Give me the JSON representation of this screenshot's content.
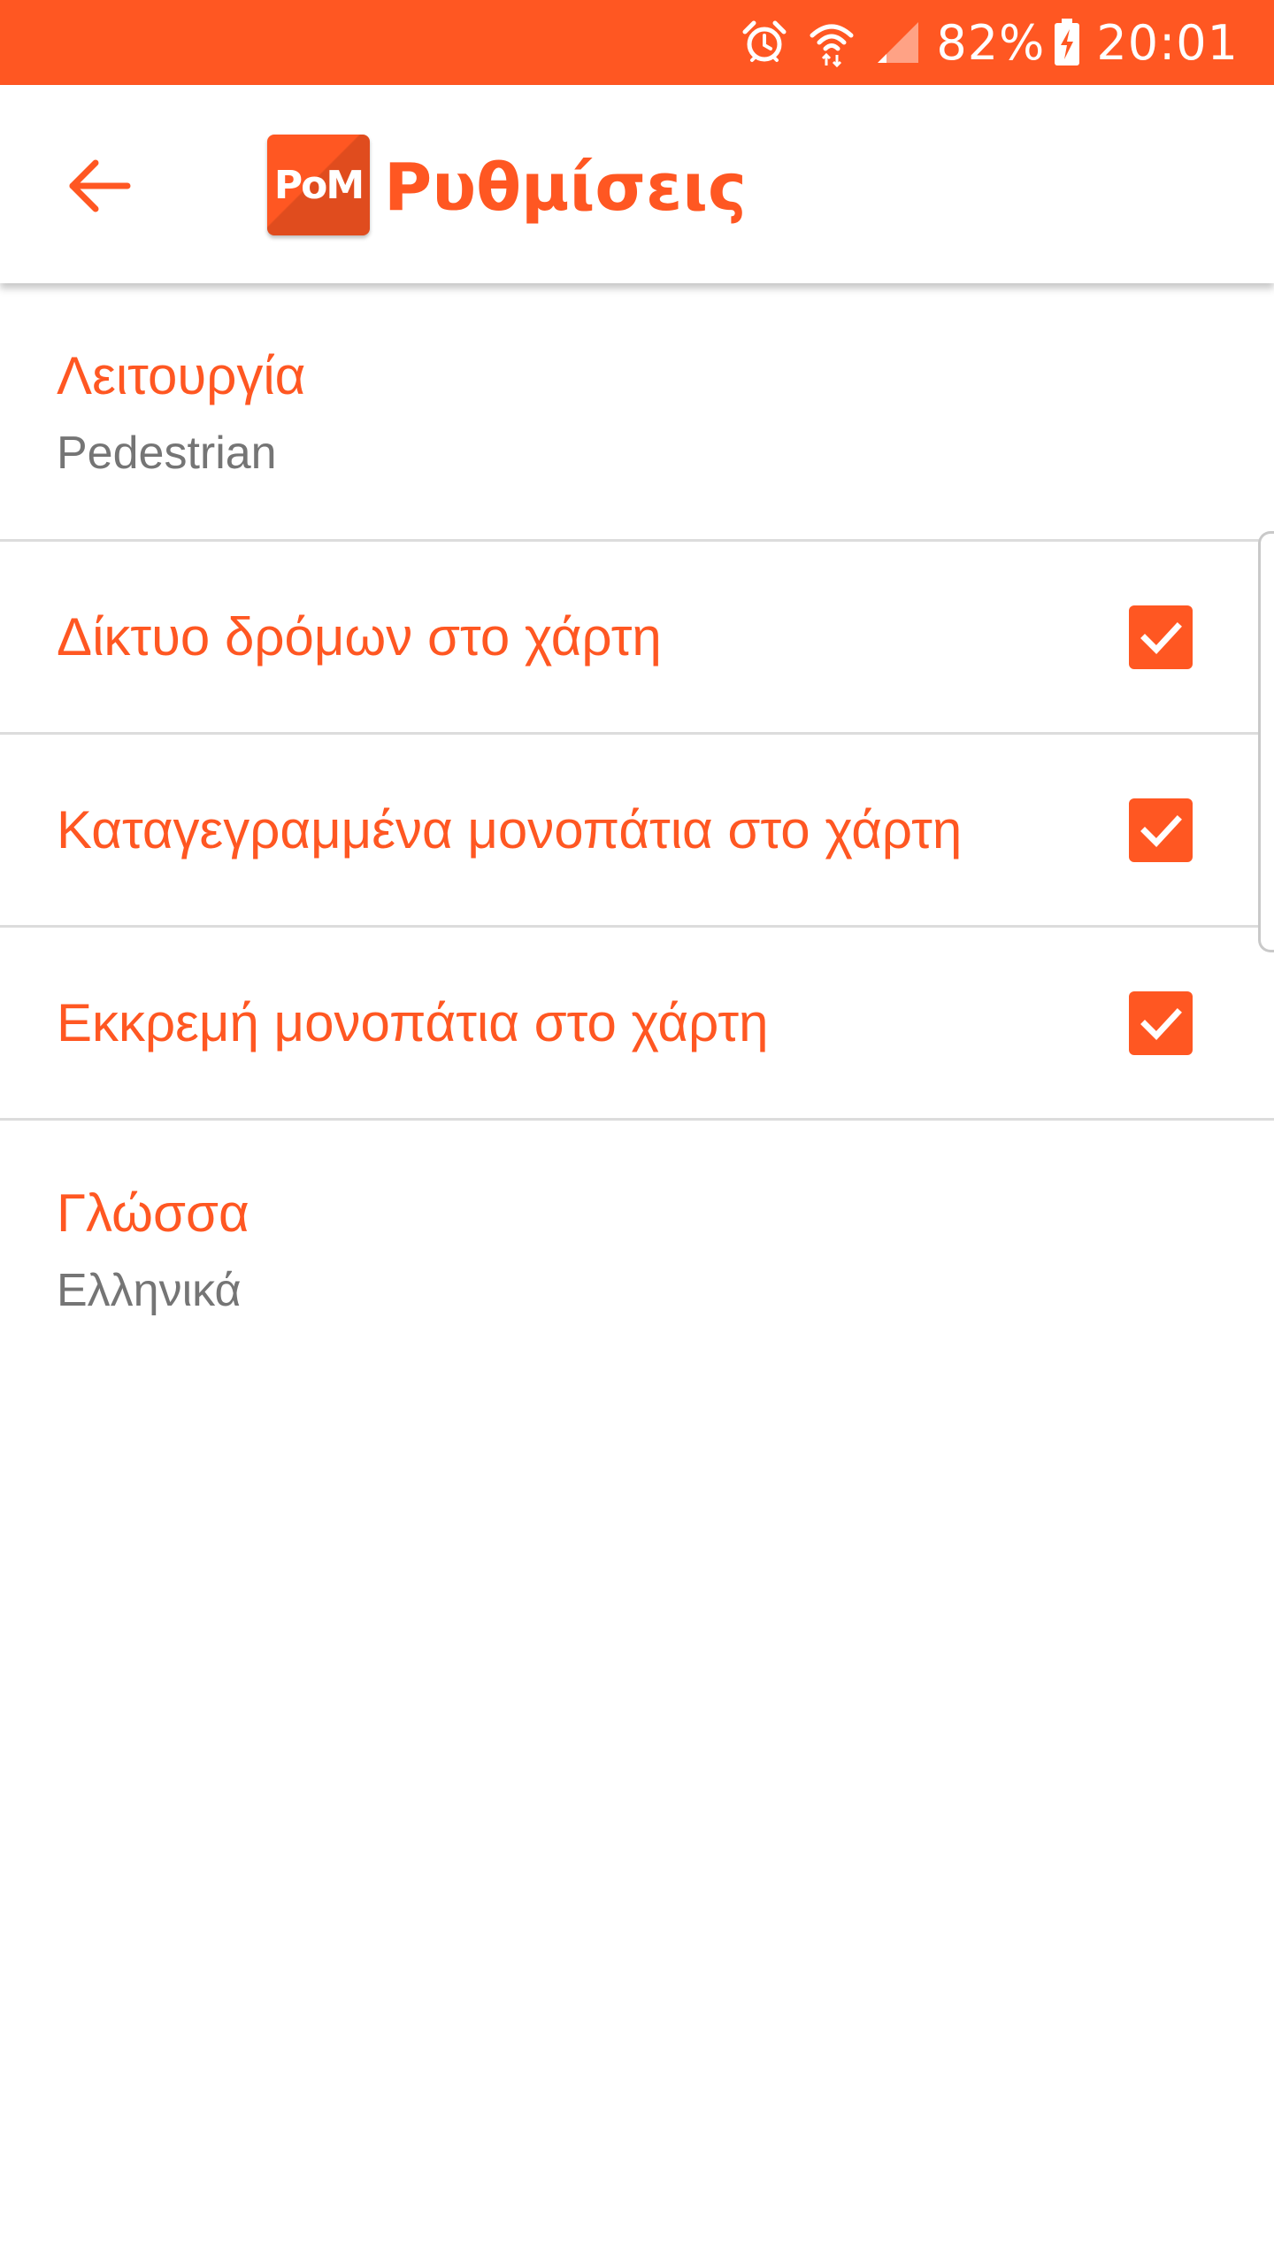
{
  "status_bar": {
    "battery": "82%",
    "time": "20:01",
    "icons": [
      "alarm-icon",
      "wifi-icon",
      "signal-icon",
      "battery-charging-icon"
    ],
    "background_color": "#FF5722"
  },
  "app_bar": {
    "logo_text": "PoM",
    "title": "Ρυθμίσεις",
    "back_icon": "arrow-left-icon"
  },
  "theme": {
    "accent": "#FF5722",
    "summary_text": "#757575",
    "divider": "#DCDCDC"
  },
  "preferences": [
    {
      "title": "Λειτουργία",
      "summary": "Pedestrian"
    },
    {
      "title": "Δίκτυο δρόμων στο χάρτη",
      "checked": true
    },
    {
      "title": "Καταγεγραμμένα μονοπάτια στο χάρτη",
      "checked": true
    },
    {
      "title": "Εκκρεμή μονοπάτια στο χάρτη",
      "checked": true
    },
    {
      "title": "Γλώσσα",
      "summary": "Ελληνικά"
    }
  ]
}
